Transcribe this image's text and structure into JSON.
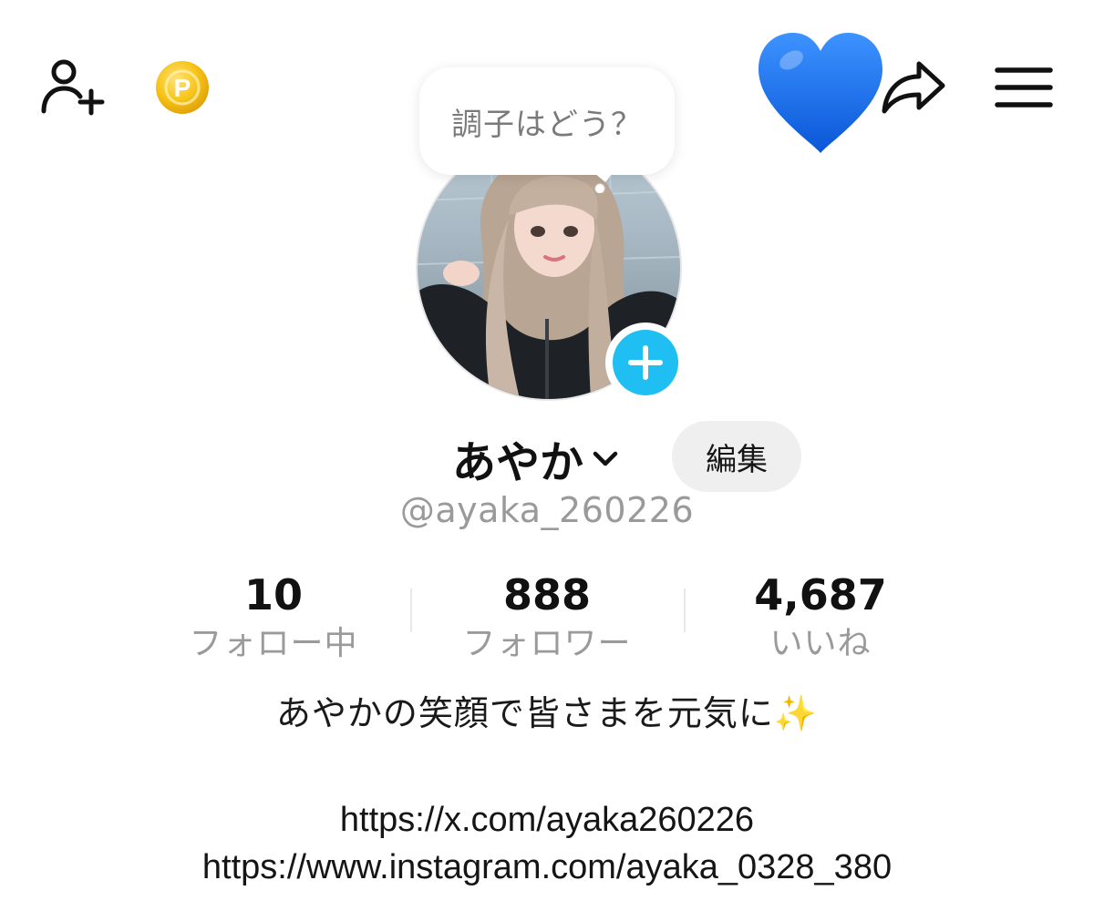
{
  "header": {
    "add_friend_icon": "person-plus-icon",
    "coin_icon": "p-coin-icon",
    "heart_emoji": "blue-heart-emoji",
    "share_icon": "share-arrow-icon",
    "menu_icon": "hamburger-menu-icon"
  },
  "status_bubble": {
    "text": "調子はどう？"
  },
  "profile": {
    "name": "あやか",
    "edit_label": "編集",
    "handle": "@ayaka_260226",
    "bio": "あやかの笑顔で皆さまを元気に✨",
    "links": [
      "https://x.com/ayaka260226",
      "https://www.instagram.com/ayaka_0328_380"
    ]
  },
  "stats": [
    {
      "value": "10",
      "label": "フォロー中"
    },
    {
      "value": "888",
      "label": "フォロワー"
    },
    {
      "value": "4,687",
      "label": "いいね"
    }
  ],
  "colors": {
    "accent_blue": "#1fbef3",
    "heart_blue": "#1a6ff0",
    "coin_gold": "#f5c21a",
    "muted_text": "#9a9a9a"
  }
}
